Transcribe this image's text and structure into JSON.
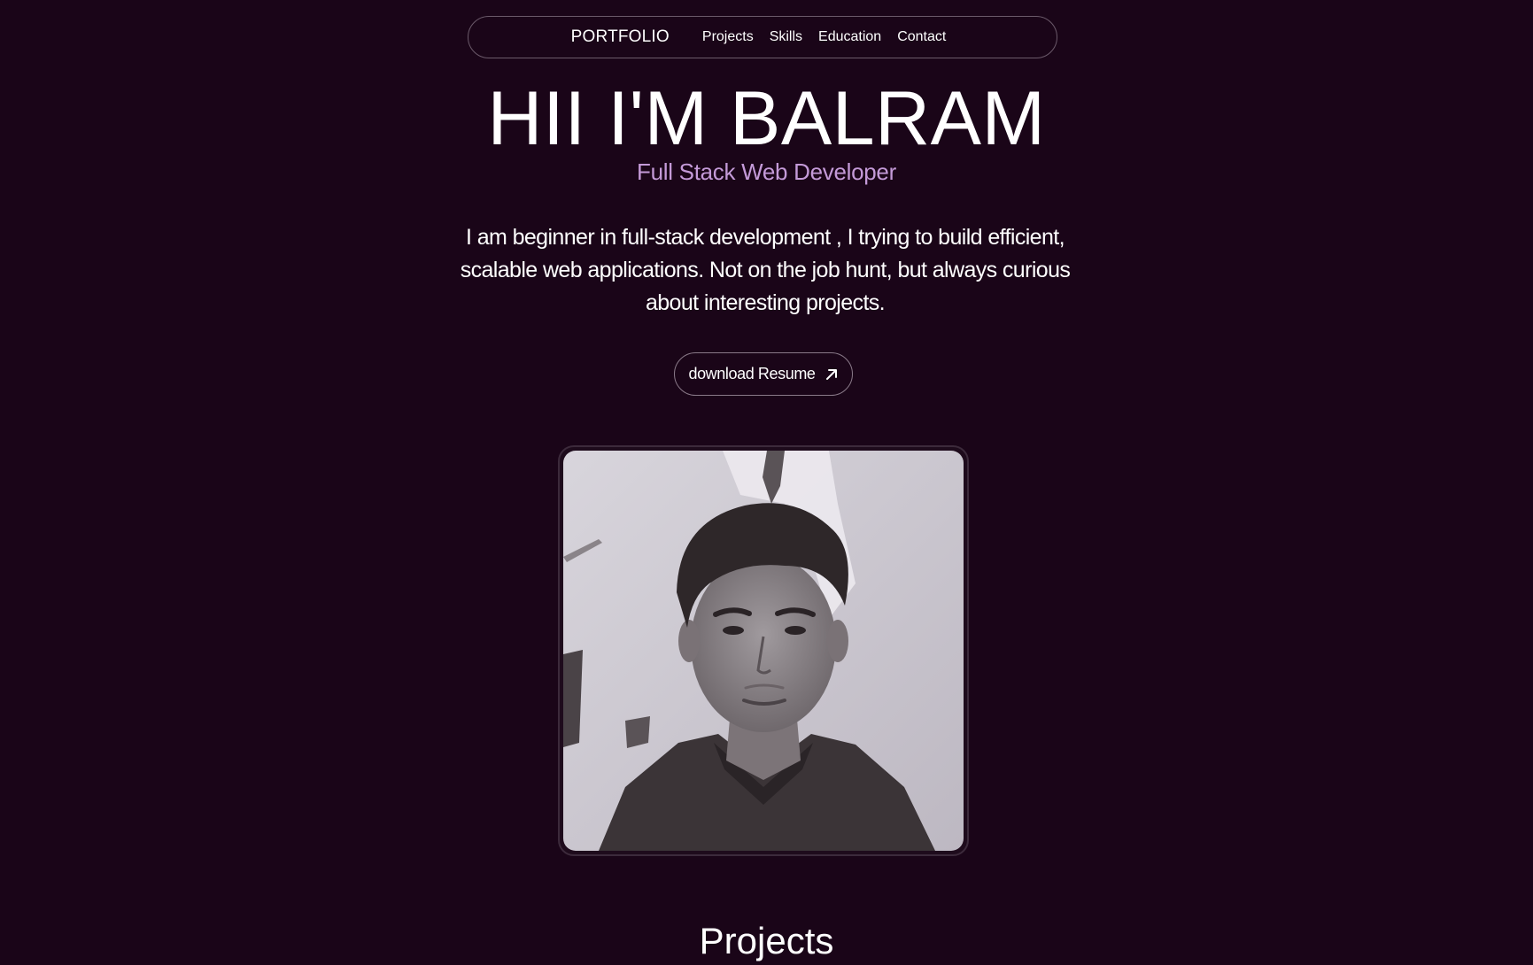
{
  "nav": {
    "brand": "PORTFOLIO",
    "links": [
      "Projects",
      "Skills",
      "Education",
      "Contact"
    ]
  },
  "hero": {
    "title": "HII I'M BALRAM",
    "subtitle": "Full Stack Web Developer",
    "description": "I am beginner in full-stack development , I trying to build efficient, scalable web applications. Not on the job hunt, but always curious about interesting projects.",
    "resume_button": "download Resume",
    "resume_icon": "arrow-up-right-icon"
  },
  "sections": {
    "projects_title": "Projects"
  },
  "colors": {
    "background": "#1a0518",
    "accent": "#c49ad8",
    "text": "#ffffff"
  }
}
